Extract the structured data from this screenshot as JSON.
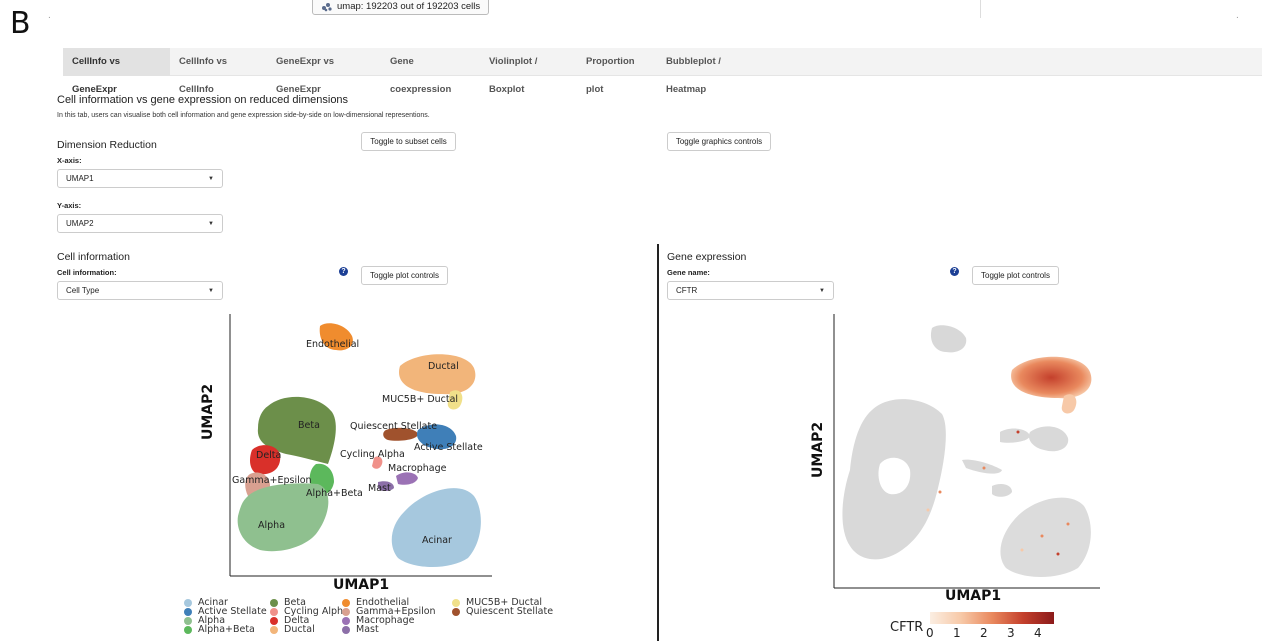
{
  "panel_letter": "B",
  "top_badge": {
    "icon": "scatter-icon",
    "text": "umap: 192203 out of 192203 cells"
  },
  "tabs": [
    {
      "label": "CellInfo vs GeneExpr",
      "active": true
    },
    {
      "label": "CellInfo vs CellInfo",
      "active": false
    },
    {
      "label": "GeneExpr vs GeneExpr",
      "active": false
    },
    {
      "label": "Gene coexpression",
      "active": false
    },
    {
      "label": "Violinplot / Boxplot",
      "active": false
    },
    {
      "label": "Proportion plot",
      "active": false
    },
    {
      "label": "Bubbleplot / Heatmap",
      "active": false
    }
  ],
  "main": {
    "title": "Cell information vs gene expression on reduced dimensions",
    "description": "In this tab, users can visualise both cell information and gene expression side-by-side on low-dimensional representions."
  },
  "dimred": {
    "heading": "Dimension Reduction",
    "x_label": "X-axis:",
    "x_value": "UMAP1",
    "y_label": "Y-axis:",
    "y_value": "UMAP2",
    "toggle_subset": "Toggle to subset cells",
    "toggle_graphics": "Toggle graphics controls"
  },
  "cellinfo": {
    "heading": "Cell information",
    "label": "Cell information:",
    "value": "Cell Type",
    "toggle": "Toggle plot controls",
    "help": "?",
    "xlabel": "UMAP1",
    "ylabel": "UMAP2",
    "clusters": [
      {
        "name": "Acinar",
        "color": "#a6c8de"
      },
      {
        "name": "Active Stellate",
        "color": "#3f7fb8"
      },
      {
        "name": "Alpha",
        "color": "#8fc08f"
      },
      {
        "name": "Alpha+Beta",
        "color": "#5cb85c"
      },
      {
        "name": "Beta",
        "color": "#6c8f4a"
      },
      {
        "name": "Cycling Alpha",
        "color": "#f0918a"
      },
      {
        "name": "Delta",
        "color": "#d9302a"
      },
      {
        "name": "Ductal",
        "color": "#f2b57a"
      },
      {
        "name": "Endothelial",
        "color": "#f08c2e"
      },
      {
        "name": "Gamma+Epsilon",
        "color": "#d9a090"
      },
      {
        "name": "Macrophage",
        "color": "#9b72b5"
      },
      {
        "name": "Mast",
        "color": "#8c6fa8"
      },
      {
        "name": "MUC5B+ Ductal",
        "color": "#f0e08a"
      },
      {
        "name": "Quiescent Stellate",
        "color": "#a0522d"
      }
    ]
  },
  "geneexpr": {
    "heading": "Gene expression",
    "label": "Gene name:",
    "value": "CFTR",
    "toggle": "Toggle plot controls",
    "help": "?",
    "xlabel": "UMAP1",
    "ylabel": "UMAP2",
    "colorbar_title": "CFTR",
    "colorbar_ticks": [
      "0",
      "1",
      "2",
      "3",
      "4"
    ],
    "colorbar_colors": [
      "#fbeee2",
      "#f7c9a8",
      "#e9895e",
      "#c4402c",
      "#8b1a1a"
    ]
  }
}
